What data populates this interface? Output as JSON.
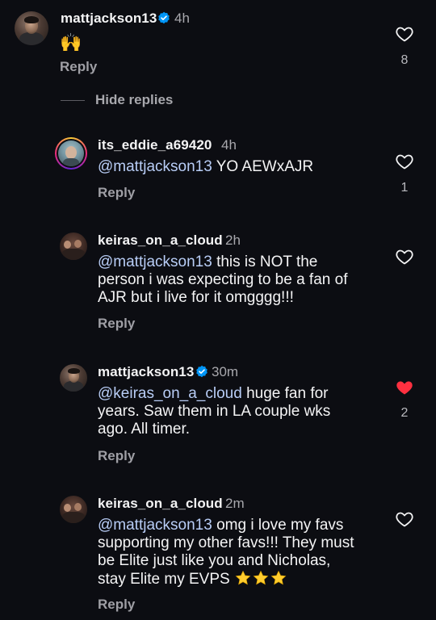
{
  "thread": {
    "top_comment": {
      "username": "mattjackson13",
      "time": "4h",
      "text": "🙌",
      "reply_label": "Reply",
      "likes": "8",
      "verified": true
    },
    "hide_replies_label": "Hide replies",
    "replies": [
      {
        "username": "its_eddie_a69420",
        "time": "4h",
        "mention": "@mattjackson13",
        "text": " YO AEWxAJR",
        "reply_label": "Reply",
        "likes": "1",
        "liked": false
      },
      {
        "username": "keiras_on_a_cloud",
        "time": "2h",
        "mention": "@mattjackson13",
        "text_lines": [
          " this is NOT the",
          "person i was expecting to be a fan of",
          "AJR but i live for it omgggg!!!"
        ],
        "reply_label": "Reply",
        "likes": "",
        "liked": false
      },
      {
        "username": "mattjackson13",
        "time": "30m",
        "verified": true,
        "mention": "@keiras_on_a_cloud",
        "text_lines": [
          " huge fan for",
          "years. Saw them in LA couple wks",
          "ago. All timer."
        ],
        "reply_label": "Reply",
        "likes": "2",
        "liked": true
      },
      {
        "username": "keiras_on_a_cloud",
        "time": "2m",
        "mention": "@mattjackson13",
        "text_lines": [
          " omg i love my favs",
          "supporting my other favs!!! They must",
          "be Elite just like you and Nicholas,",
          "stay Elite my EVPS"
        ],
        "emojis": "⭐⭐⭐",
        "reply_label": "Reply",
        "likes": "",
        "liked": false
      }
    ]
  },
  "colors": {
    "background": "#0c0d12",
    "mention": "#b8cdf6",
    "verified": "#0095f6",
    "liked_heart": "#ff3040"
  },
  "icons": [
    "verified-badge-icon",
    "heart-icon",
    "heart-filled-icon",
    "star-emoji"
  ]
}
